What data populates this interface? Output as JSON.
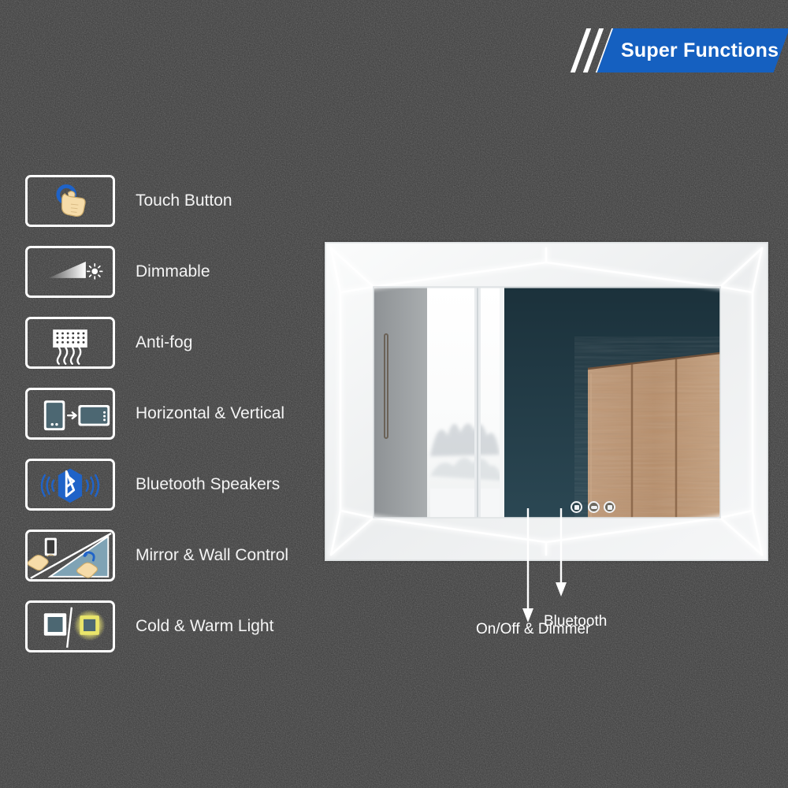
{
  "banner": {
    "title": "Super Functions",
    "accent_color": "#1560c0",
    "stripe_color": "#ffffff",
    "stripe_count": 3
  },
  "background": {
    "color": "#3a3a3a",
    "texture": "noise"
  },
  "features": [
    {
      "label": "Touch Button",
      "icon": "touch-button-icon"
    },
    {
      "label": "Dimmable",
      "icon": "dimmable-icon"
    },
    {
      "label": "Anti-fog",
      "icon": "anti-fog-icon"
    },
    {
      "label": "Horizontal & Vertical",
      "icon": "horizontal-vertical-icon"
    },
    {
      "label": "Bluetooth Speakers",
      "icon": "bluetooth-speaker-icon"
    },
    {
      "label": "Mirror & Wall Control",
      "icon": "mirror-wall-control-icon"
    },
    {
      "label": "Cold & Warm Light",
      "icon": "cold-warm-light-icon"
    }
  ],
  "product": {
    "type": "led-bathroom-mirror",
    "frame_color": "#f2f3f4",
    "led_color": "#ffffff",
    "reflection": {
      "scene": "bathroom interior reflection",
      "elements": [
        {
          "name": "gray-door-panel",
          "color": "#9a9ea1"
        },
        {
          "name": "window-with-snow",
          "color": "#fbfbfb"
        },
        {
          "name": "dark-teal-wall",
          "color": "#223740"
        },
        {
          "name": "wood-panels",
          "color": "#bb9272",
          "count": 3
        }
      ]
    },
    "touch_buttons": [
      {
        "name": "on-off-dimmer-button",
        "symbol": "power"
      },
      {
        "name": "anti-fog-button",
        "symbol": "defog"
      },
      {
        "name": "bluetooth-button",
        "symbol": "bluetooth"
      }
    ]
  },
  "callouts": [
    {
      "label": "Bluetooth",
      "target": "bluetooth-button"
    },
    {
      "label": "On/Off & Dimmer",
      "target": "on-off-dimmer-button"
    }
  ]
}
